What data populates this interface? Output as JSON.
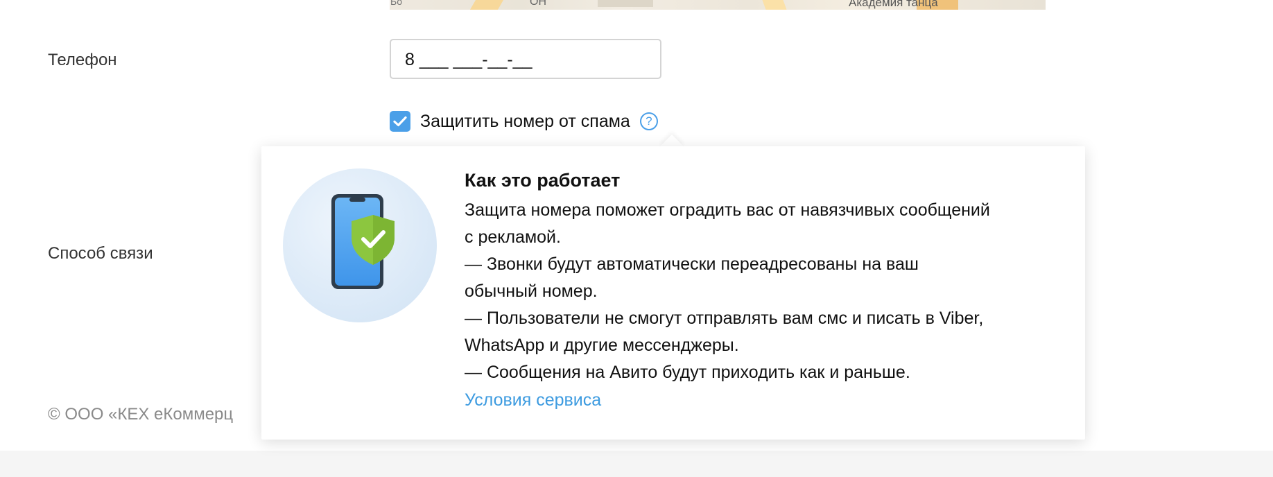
{
  "map": {
    "label_main": "Академия танца",
    "label_left": "Бо",
    "label_mid": "ОН"
  },
  "form": {
    "phone_label": "Телефон",
    "phone_value": "8 ___ ___-__-__",
    "spam_checkbox_label": "Защитить номер от спама",
    "spam_checked": true,
    "help_glyph": "?",
    "contact_label": "Способ связи"
  },
  "popup": {
    "title": "Как это работает",
    "lines": [
      "Защита номера поможет оградить вас от навязчивых сообщений",
      "с рекламой.",
      "— Звонки будут автоматически переадресованы на ваш",
      "обычный номер.",
      "— Пользователи не смогут отправлять вам смс и писать в Viber,",
      "WhatsApp и другие мессенджеры.",
      "— Сообщения на Авито будут приходить как и раньше."
    ],
    "link": "Условия сервиса"
  },
  "footer": {
    "text": "© ООО «КЕХ еКоммерц"
  },
  "colors": {
    "accent": "#4a9fe8",
    "link": "#3d9be0",
    "shield": "#8cc63f"
  },
  "icons": {
    "checkbox": "check-icon",
    "help": "question-icon",
    "illustration": "phone-shield-icon"
  }
}
